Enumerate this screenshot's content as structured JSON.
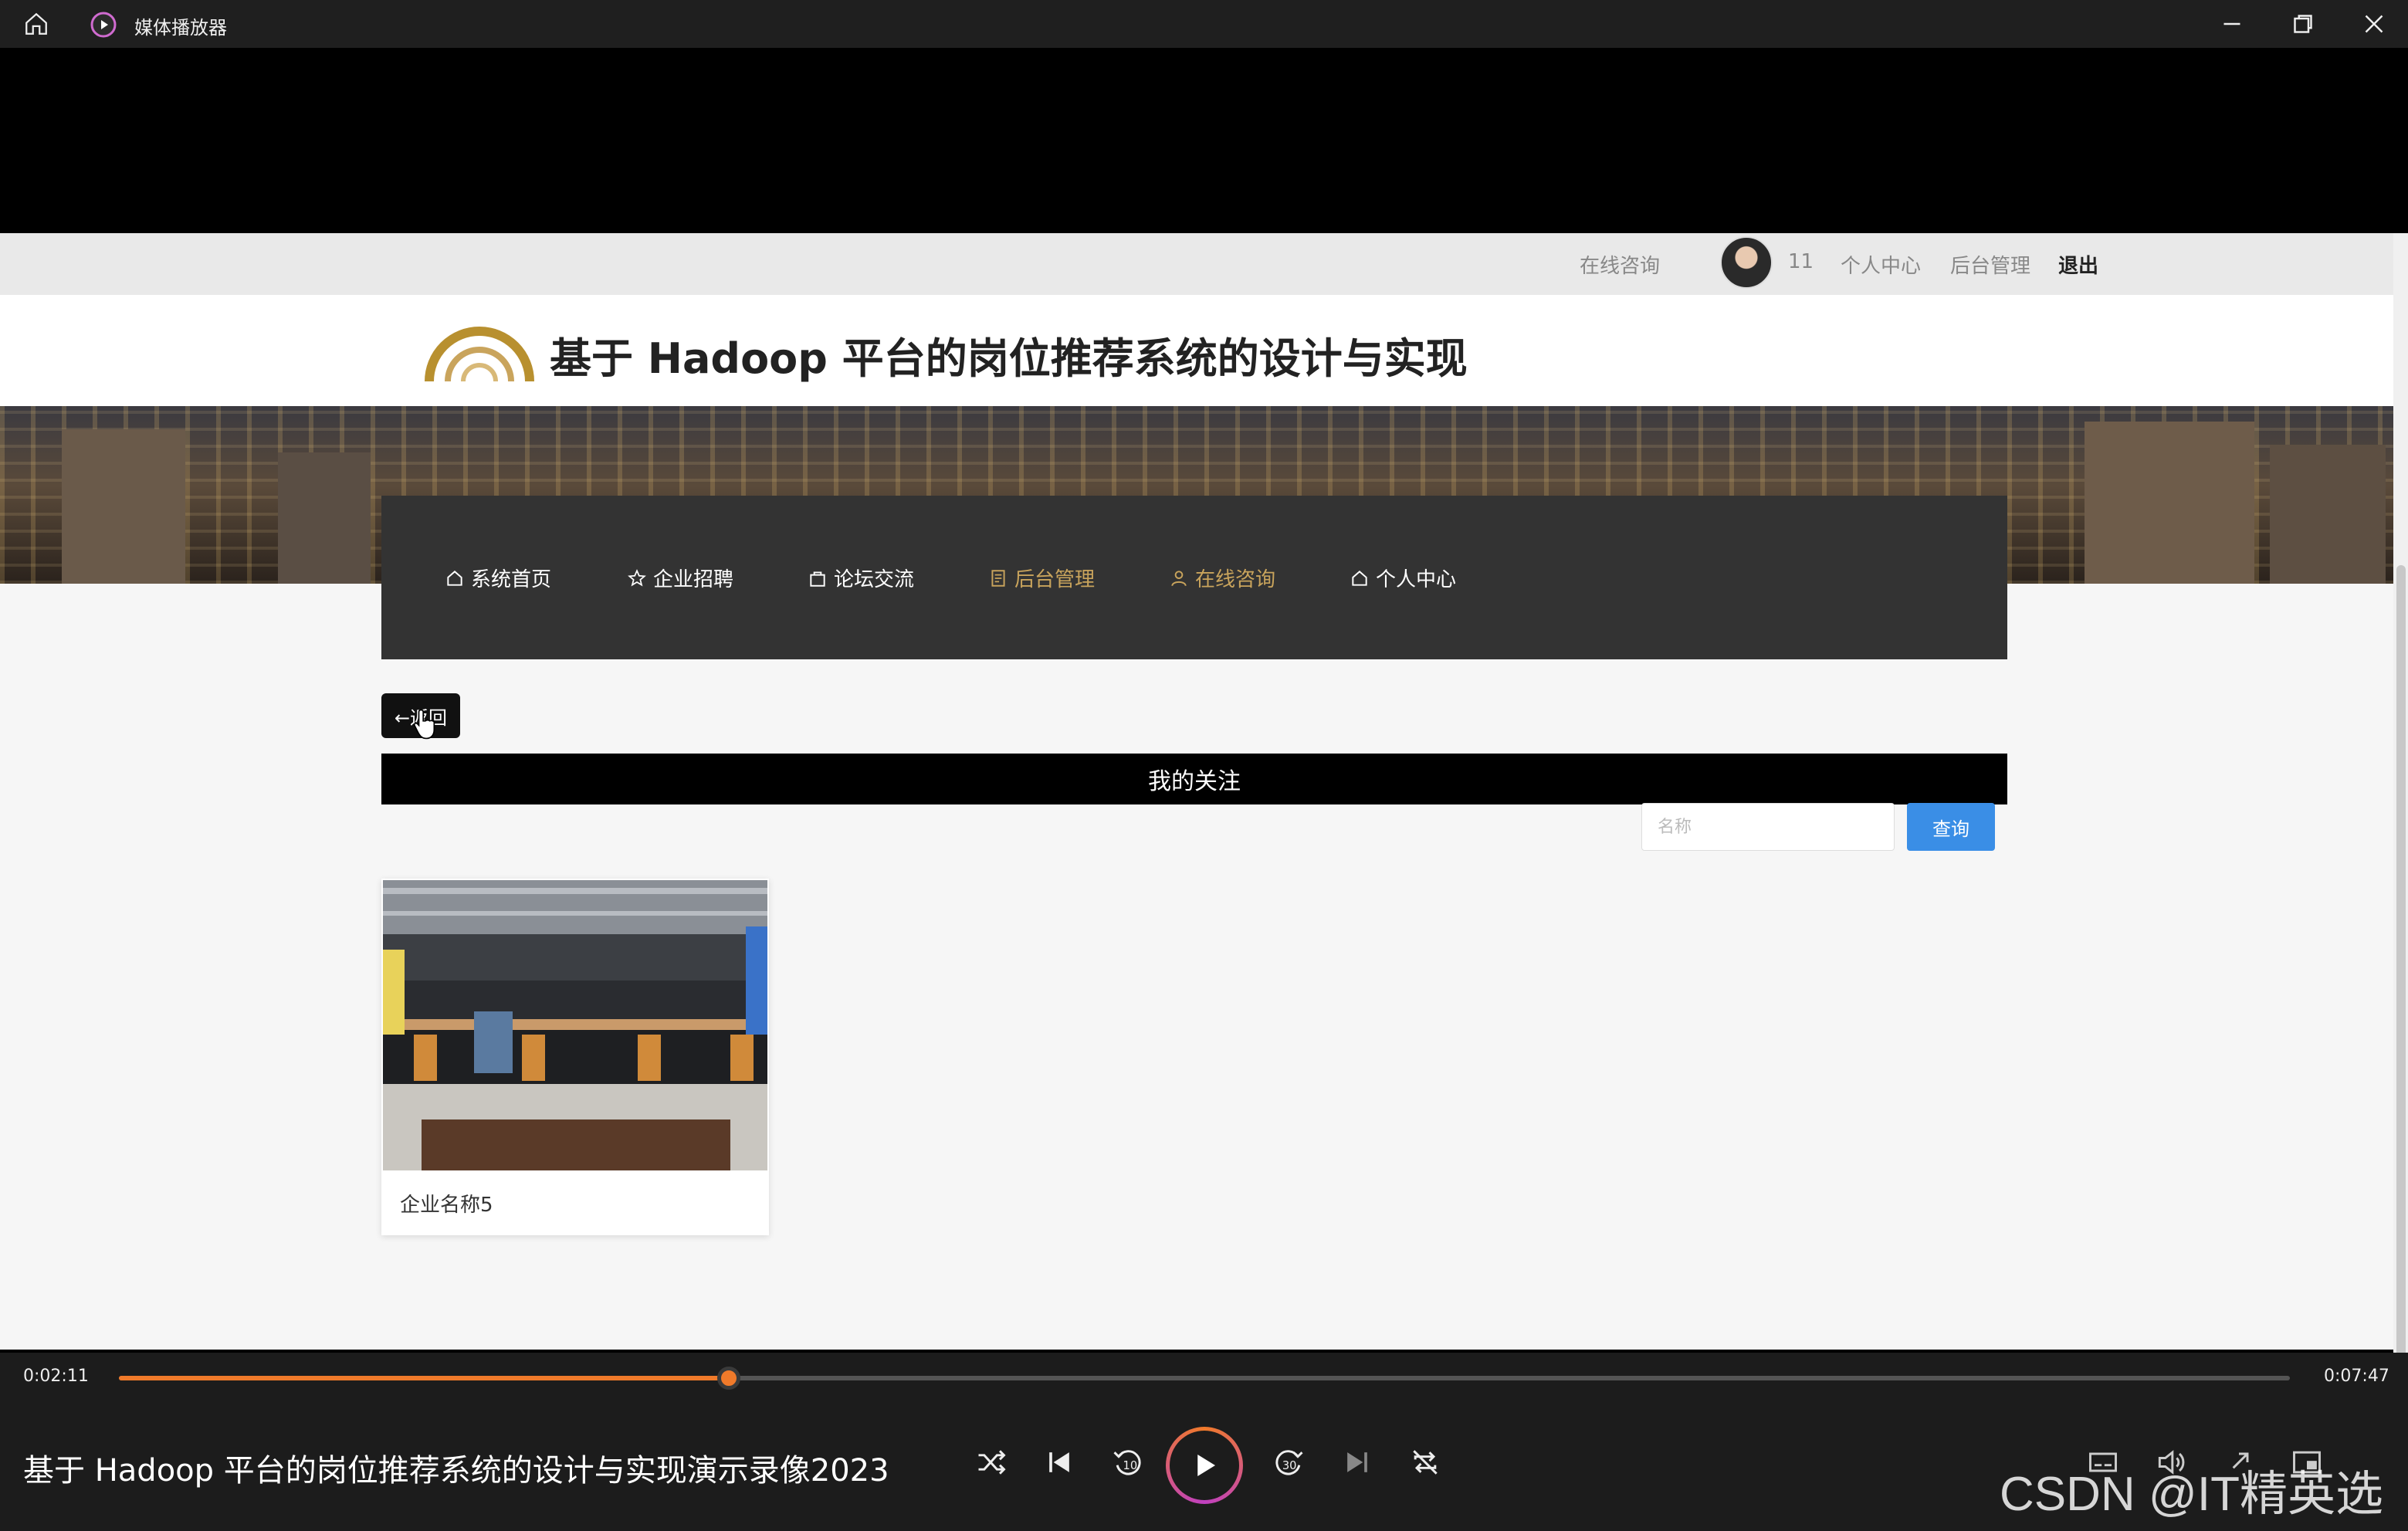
{
  "player": {
    "app_title": "媒体播放器",
    "current_time": "0:02:11",
    "total_time": "0:07:47",
    "progress": 0.281,
    "video_title": "基于 Hadoop 平台的岗位推荐系统的设计与实现演示录像2023",
    "watermark": "CSDN @IT精英选手",
    "accent_color": "#f07a2a"
  },
  "site": {
    "top_bar": {
      "consult": "在线咨询",
      "username": "11",
      "personal": "个人中心",
      "admin": "后台管理",
      "logout": "退出"
    },
    "title": "基于 Hadoop 平台的岗位推荐系统的设计与实现",
    "nav": [
      {
        "label": "系统首页",
        "icon": "home-icon"
      },
      {
        "label": "企业招聘",
        "icon": "star-icon"
      },
      {
        "label": "论坛交流",
        "icon": "bag-icon"
      },
      {
        "label": "后台管理",
        "icon": "document-icon"
      },
      {
        "label": "在线咨询",
        "icon": "user-icon"
      },
      {
        "label": "个人中心",
        "icon": "home-icon"
      }
    ],
    "back_label": "←返回",
    "section_title": "我的关注",
    "search": {
      "placeholder": "名称",
      "button": "查询"
    },
    "cards": [
      {
        "name": "企业名称5"
      }
    ],
    "colors": {
      "navbar": "#333333",
      "nav_active": "#c9a45c",
      "search_button": "#3a8ee6"
    }
  }
}
